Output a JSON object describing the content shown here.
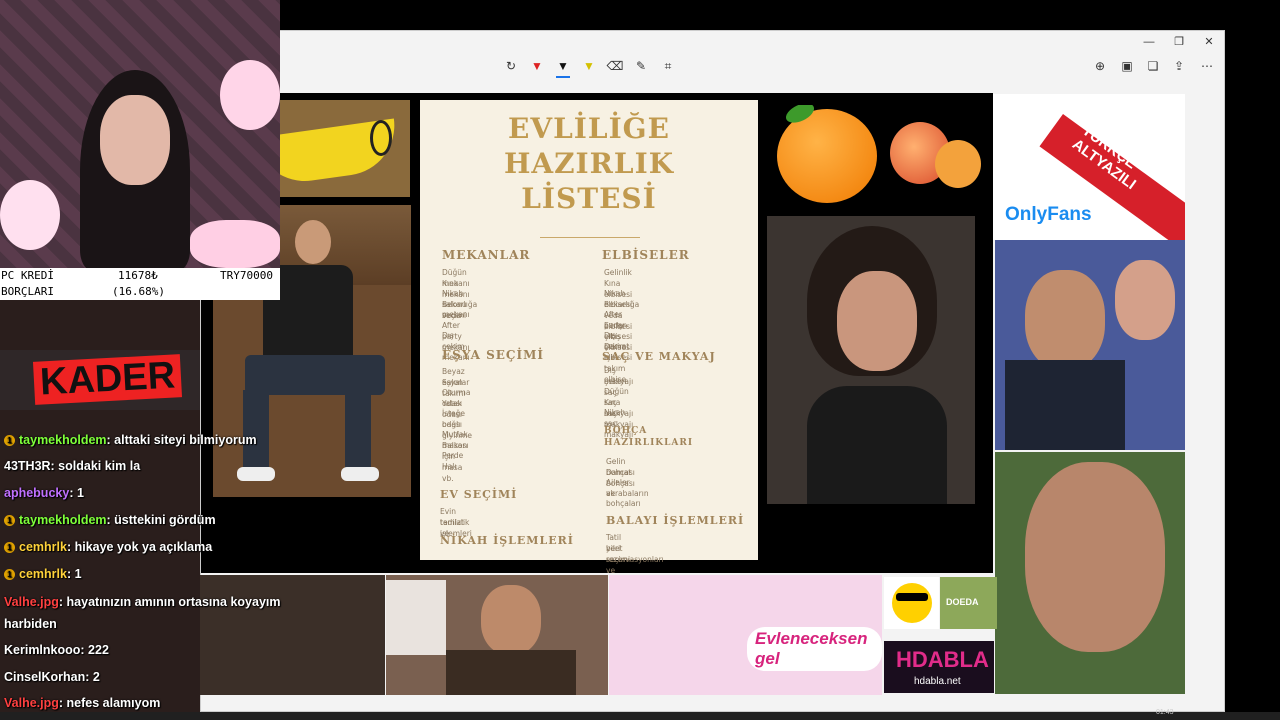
{
  "toolbar": {
    "icons": [
      "crop-rotate-icon",
      "pen-red-icon",
      "pen-black-icon",
      "highlighter-icon",
      "eraser-icon",
      "edit-icon",
      "crop-icon"
    ]
  },
  "right_tools": [
    "zoom-icon",
    "save-icon",
    "copy-icon",
    "share-icon",
    "more-icon"
  ],
  "credit": {
    "row1_left": "PC KREDİ",
    "row1_mid": "11678₺",
    "row1_right": "TRY70000",
    "row2_left": "BORÇLARI",
    "row2_mid": "(16.68%)"
  },
  "collage": {
    "kader_title": "KADER",
    "turkce": "TÜRKÇE ALTYAZILI",
    "onlyfans": "OnlyFans",
    "evlen": "Evleneceksen gel",
    "doeda": "DOEDA",
    "hdabla": "HDABLA",
    "hdabla_url": "hdabla.net"
  },
  "doc": {
    "title": [
      "EVLİLİĞE",
      "HAZIRLIK",
      "LİSTESİ"
    ],
    "mekanlar": "MEKANLAR",
    "mekanlar_items": [
      "Düğün mekanı",
      "Kına mekanı",
      "Nikah salonu seçimi",
      "Bekarlığa veda",
      "mekanı",
      "After party mekanı",
      "Dış çekim mekanı"
    ],
    "esya": "EŞYA SEÇİMİ",
    "esya_items": [
      "Beyaz eşyalar",
      "Salon takımı",
      "Oturma odası",
      "Yatak odası",
      "İsteğe bağlı giyinme",
      "odası",
      "Mutfak masası",
      "Balkon için masa vb.",
      "Perde",
      "Halı"
    ],
    "ev": "EV SEÇİMİ",
    "ev_items": [
      "Evin tadilat ve",
      "temizlik işlemleri"
    ],
    "nikah": "NİKAH İŞLEMLERİ",
    "elbiseler": "ELBİSELER",
    "elbiseler_items": [
      "Gelinlik",
      "Kına elbisesi",
      "Nikah elbisesi",
      "Bekarlığa veda elbisesi",
      "After party elbisesi",
      "Evden çıkış elbisesi",
      "Dış çekim elbisesi",
      "Damat için takım elbise"
    ],
    "sac": "SAÇ VE MAKYAJ",
    "sac_items": [
      "Dış çekim saç",
      "makyajı",
      "Düğün saç makyajı",
      "Kına saç makyajı",
      "Nikah saç makyajı"
    ],
    "bohca": "BOHÇA",
    "bohca2": "HAZIRLIKLARI",
    "bohca_items": [
      "Gelin bohçası",
      "Damat bohçası",
      "Aileler ve",
      "akrabaların",
      "bohçaları"
    ],
    "balayi": "BALAYI İŞLEMLERİ",
    "balayi_items": [
      "Tatil yeri seçimi ve",
      "bilet rezervasyonları"
    ]
  },
  "chat": [
    {
      "user": "taymekholdem",
      "color": "#7fff3a",
      "msg": ": alttaki siteyi bilmiyorum",
      "badge": "1"
    },
    {
      "user": "43TH3R",
      "color": "#ffffff",
      "msg": ": soldaki kim la",
      "badge": ""
    },
    {
      "user": "aphebucky",
      "color": "#c070ff",
      "msg": ": 1",
      "badge": ""
    },
    {
      "user": "taymekholdem",
      "color": "#7fff3a",
      "msg": ": üsttekini gördüm",
      "badge": "1"
    },
    {
      "user": "cemhrlk",
      "color": "#ffd23a",
      "msg": ": hikaye yok ya açıklama",
      "badge": "1"
    },
    {
      "user": "cemhrlk",
      "color": "#ffd23a",
      "msg": ": 1",
      "badge": "1"
    },
    {
      "user": "Valhe.jpg",
      "color": "#ff4040",
      "msg": ": hayatınızın amının ortasına koyayım",
      "badge": ""
    },
    {
      "user": "",
      "color": "#ffffff",
      "msg": "harbiden",
      "badge": ""
    },
    {
      "user": "Kerimlnkooo",
      "color": "#ffffff",
      "msg": ": 222",
      "badge": ""
    },
    {
      "user": "CinselKorhan",
      "color": "#ffffff",
      "msg": ": 2",
      "badge": ""
    },
    {
      "user": "Valhe.jpg",
      "color": "#ff4040",
      "msg": ": nefes alamıyom",
      "badge": ""
    }
  ],
  "clock": "01:43"
}
